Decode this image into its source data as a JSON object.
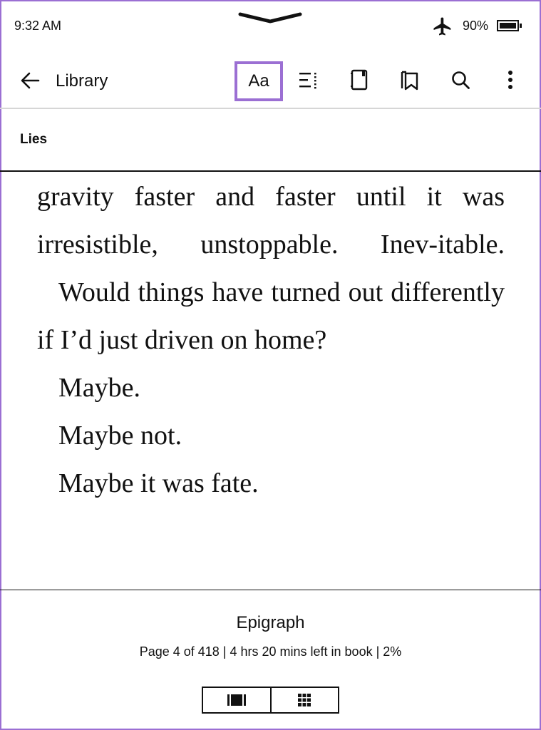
{
  "status_bar": {
    "time": "9:32 AM",
    "battery_percent": "90%",
    "airplane_mode_icon": "airplane-icon",
    "battery_level": 0.9
  },
  "toolbar": {
    "back_icon": "arrow-left-icon",
    "library_label": "Library",
    "font_settings_label": "Aa",
    "icons": [
      "contents-icon",
      "notebook-icon",
      "bookmark-icon",
      "search-icon",
      "more-vertical-icon"
    ],
    "highlight_color": "#9b6fd3"
  },
  "book": {
    "title": "Lies"
  },
  "page_text": {
    "paragraphs": [
      {
        "text": "gravity faster and faster until it was irresistible, unstoppable. Inev-itable.",
        "indent": false
      },
      {
        "text": "Would things have turned out differently if I’d just driven on home?",
        "indent": true
      },
      {
        "text": "Maybe.",
        "indent": true
      },
      {
        "text": "Maybe not.",
        "indent": true
      },
      {
        "text": "Maybe it was fate.",
        "indent": true
      }
    ]
  },
  "footer": {
    "chapter": "Epigraph",
    "progress": "Page 4 of 418 | 4 hrs 20 mins left in book | 2%",
    "view_toggle": [
      "page-view-icon",
      "grid-view-icon"
    ]
  }
}
